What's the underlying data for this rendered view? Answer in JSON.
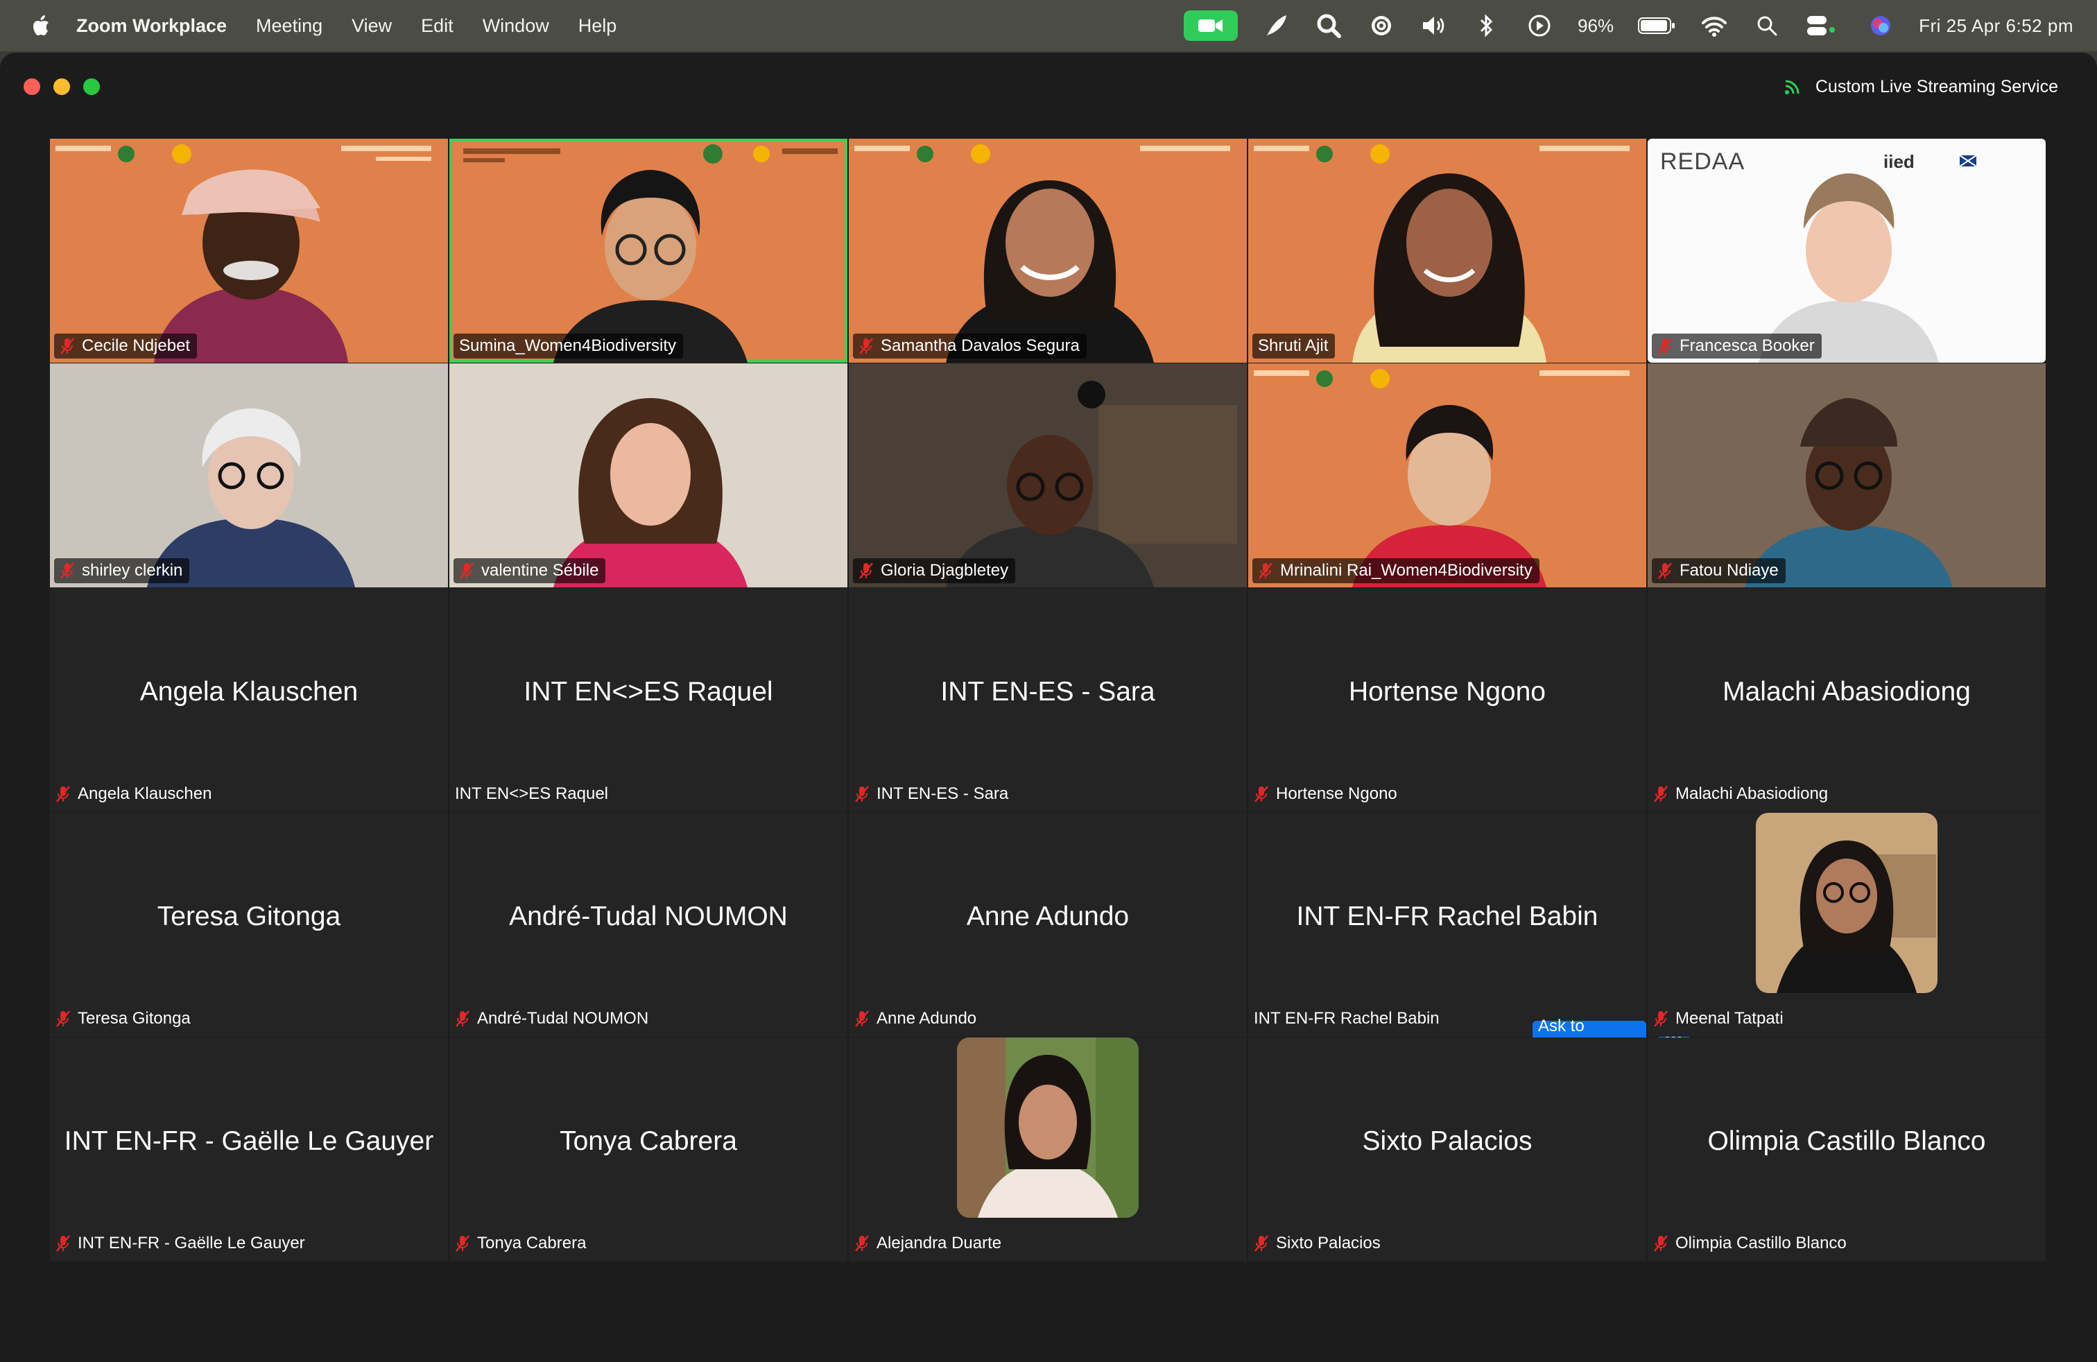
{
  "menubar": {
    "app_name": "Zoom Workplace",
    "menus": [
      "Meeting",
      "View",
      "Edit",
      "Window",
      "Help"
    ],
    "battery": "96%",
    "clock": "Fri 25 Apr  6:52 pm"
  },
  "window": {
    "streaming_label": "Custom Live Streaming Service"
  },
  "participants": [
    {
      "name": "Cecile Ndjebet",
      "muted": true
    },
    {
      "name": "Sumina_Women4Biodiversity",
      "muted": false,
      "active_speaker": true
    },
    {
      "name": "Samantha Davalos Segura",
      "muted": true
    },
    {
      "name": "Shruti Ajit",
      "muted": false
    },
    {
      "name": "Francesca Booker",
      "muted": true
    },
    {
      "name": "shirley clerkin",
      "muted": true
    },
    {
      "name": "valentine Sébile",
      "muted": true
    },
    {
      "name": "Gloria Djagbletey",
      "muted": true
    },
    {
      "name": "Mrinalini Rai_Women4Biodiversity",
      "muted": true
    },
    {
      "name": "Fatou Ndiaye",
      "muted": true
    },
    {
      "name": "Angela Klauschen",
      "muted": true,
      "display": "Angela Klauschen"
    },
    {
      "name": "INT EN<>ES Raquel",
      "muted": false,
      "display": "INT EN<>ES Raquel"
    },
    {
      "name": "INT EN-ES - Sara",
      "muted": true,
      "display": "INT EN-ES - Sara"
    },
    {
      "name": "Hortense Ngono",
      "muted": true,
      "display": "Hortense Ngono"
    },
    {
      "name": "Malachi Abasiodiong",
      "muted": true,
      "display": "Malachi Abasiodiong"
    },
    {
      "name": "Teresa Gitonga",
      "muted": true,
      "display": "Teresa Gitonga"
    },
    {
      "name": "André-Tudal NOUMON",
      "muted": true,
      "display": "André-Tudal NOUMON"
    },
    {
      "name": "Anne Adundo",
      "muted": true,
      "display": "Anne Adundo"
    },
    {
      "name": "INT EN-FR Rachel Babin",
      "muted": false,
      "display": "INT EN-FR Rachel Babin"
    },
    {
      "name": "Meenal Tatpati",
      "muted": true
    },
    {
      "name": "INT EN-FR - Gaëlle Le Gauyer",
      "muted": true,
      "display": "INT EN-FR - Gaëlle Le Gauyer"
    },
    {
      "name": "Tonya Cabrera",
      "muted": true,
      "display": "Tonya Cabrera"
    },
    {
      "name": "Alejandra Duarte",
      "muted": true
    },
    {
      "name": "Sixto Palacios",
      "muted": true,
      "display": "Sixto Palacios"
    },
    {
      "name": "Olimpia Castillo Blanco",
      "muted": true,
      "display": "Olimpia Castillo Blanco"
    }
  ],
  "controls": {
    "ask_to_unmute": "Ask to unmute",
    "more": "···"
  },
  "branding": {
    "logo_text": "REDAA",
    "org_text": "iied"
  }
}
